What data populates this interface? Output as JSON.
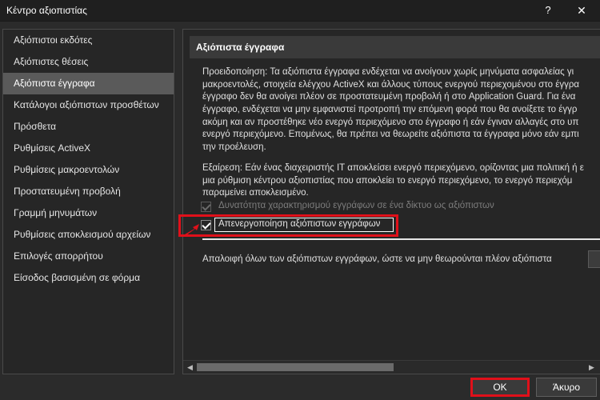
{
  "window": {
    "title": "Κέντρο αξιοπιστίας",
    "help_label": "?",
    "close_label": "✕"
  },
  "sidebar": {
    "items": [
      {
        "label": "Αξιόπιστοι εκδότες"
      },
      {
        "label": "Αξιόπιστες θέσεις"
      },
      {
        "label": "Αξιόπιστα έγγραφα",
        "selected": true
      },
      {
        "label": "Κατάλογοι αξιόπιστων προσθέτων"
      },
      {
        "label": "Πρόσθετα"
      },
      {
        "label": "Ρυθμίσεις ActiveX"
      },
      {
        "label": "Ρυθμίσεις μακροεντολών"
      },
      {
        "label": "Προστατευμένη προβολή"
      },
      {
        "label": "Γραμμή μηνυμάτων"
      },
      {
        "label": "Ρυθμίσεις αποκλεισμού αρχείων"
      },
      {
        "label": "Επιλογές απορρήτου"
      },
      {
        "label": "Είσοδος βασισμένη σε φόρμα"
      }
    ]
  },
  "content": {
    "section_title": "Αξιόπιστα έγγραφα",
    "warning_lines": [
      "Προειδοποίηση: Τα αξιόπιστα έγγραφα ενδέχεται να ανοίγουν χωρίς μηνύματα ασφαλείας γι",
      "μακροεντολές, στοιχεία ελέγχου ActiveX και άλλους τύπους ενεργού περιεχομένου στο έγγρα",
      "έγγραφο δεν θα ανοίγει πλέον σε προστατευμένη προβολή ή στο Application Guard. Για ένα",
      "έγγραφο, ενδέχεται να μην εμφανιστεί προτροπή την επόμενη φορά που θα ανοίξετε το έγγρ",
      "ακόμη και αν προστέθηκε νέο ενεργό περιεχόμενο στο έγγραφο ή εάν έγιναν αλλαγές στο υπ",
      "ενεργό περιεχόμενο. Επομένως, θα πρέπει να θεωρείτε αξιόπιστα τα έγγραφα μόνο εάν εμπι",
      "την προέλευση."
    ],
    "exception_lines": [
      "Εξαίρεση: Εάν ένας διαχειριστής IT αποκλείσει ενεργό περιεχόμενο, ορίζοντας μια πολιτική ή ε",
      "μια ρύθμιση κέντρου αξιοπιστίας που αποκλείει το ενεργό περιεχόμενο, το ενεργό περιεχόμ",
      "παραμείνει αποκλεισμένο."
    ],
    "network_checkbox": {
      "label": "Δυνατότητα χαρακτηρισμού εγγράφων σε ένα δίκτυο ως αξιόπιστων",
      "checked": true,
      "enabled": false
    },
    "disable_checkbox": {
      "label": "Απενεργοποίηση αξιόπιστων εγγράφων",
      "checked": true,
      "enabled": true
    },
    "clear_text": "Απαλοιφή όλων των αξιόπιστων εγγράφων, ώστε να μην θεωρούνται πλέον αξιόπιστα"
  },
  "footer": {
    "ok_label": "OK",
    "cancel_label": "Άκυρο"
  },
  "colors": {
    "highlight": "#e0101a",
    "selected_item_bg": "#5a5a5a",
    "window_bg": "#2b2b2b"
  }
}
